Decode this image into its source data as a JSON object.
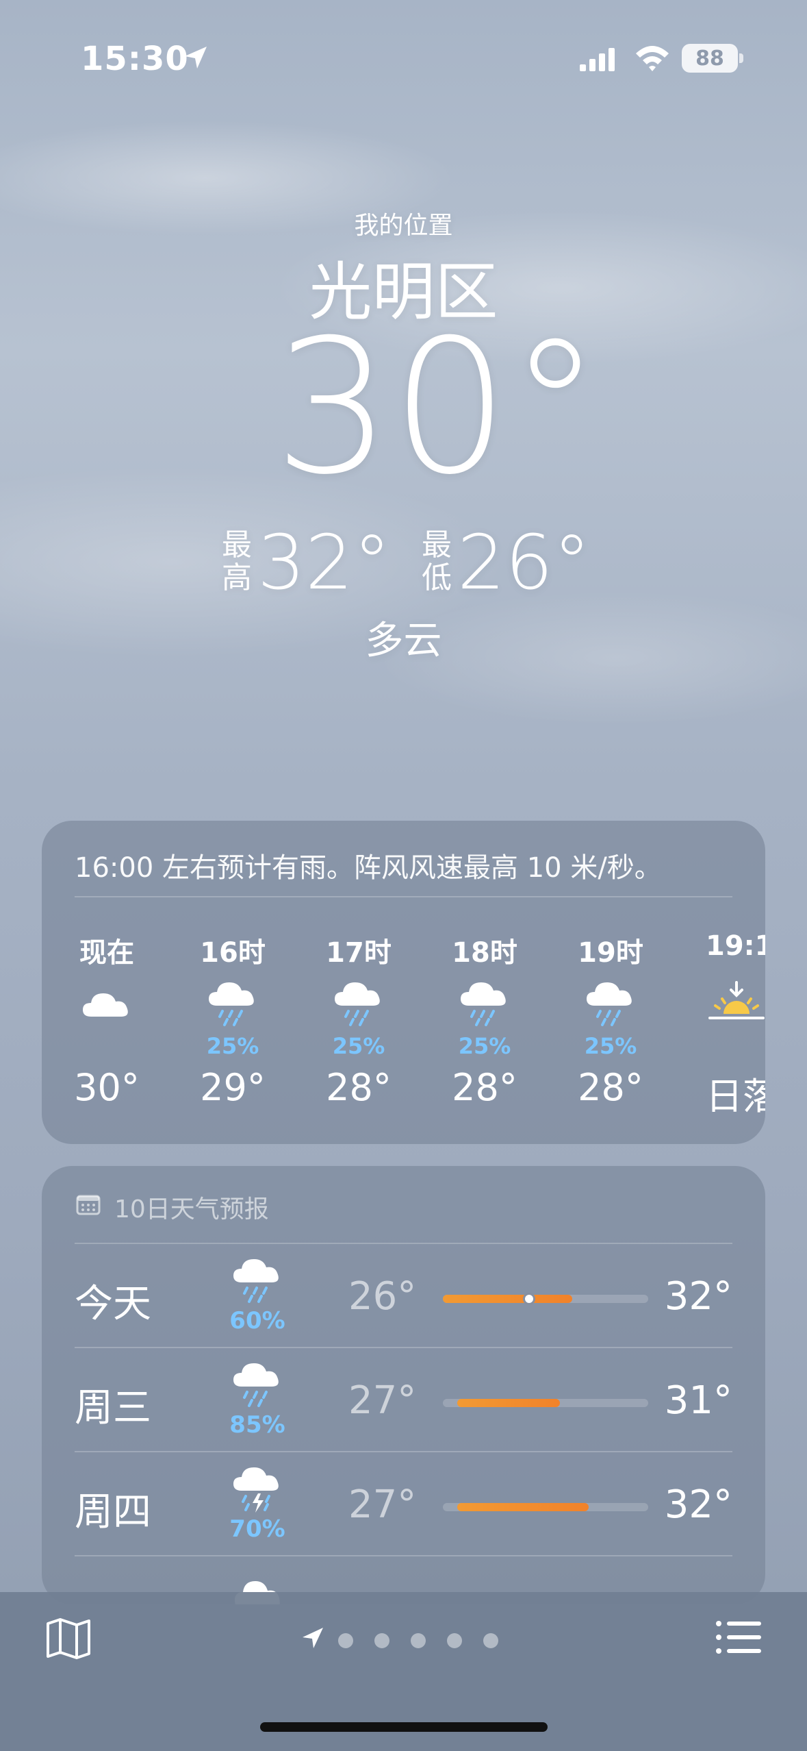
{
  "status_bar": {
    "time": "15:30",
    "battery": "88"
  },
  "header": {
    "my_location": "我的位置",
    "city": "光明区",
    "current_temp": "30°",
    "high_label": "最\n高",
    "high_label_top": "最",
    "high_label_bottom": "高",
    "high": "32°",
    "low_label_top": "最",
    "low_label_bottom": "低",
    "low": "26°",
    "condition": "多云"
  },
  "hourly": {
    "alert": "16:00 左右预计有雨。阵风风速最高 10 米/秒。",
    "hours": [
      {
        "label": "现在",
        "icon": "cloud-icon",
        "prob": "",
        "temp": "30°"
      },
      {
        "label": "16时",
        "icon": "cloud-rain-icon",
        "prob": "25%",
        "temp": "29°"
      },
      {
        "label": "17时",
        "icon": "cloud-rain-icon",
        "prob": "25%",
        "temp": "28°"
      },
      {
        "label": "18时",
        "icon": "cloud-rain-icon",
        "prob": "25%",
        "temp": "28°"
      },
      {
        "label": "19时",
        "icon": "cloud-rain-icon",
        "prob": "25%",
        "temp": "28°"
      },
      {
        "label": "19:1",
        "icon": "sunset-icon",
        "prob": "",
        "temp": "日落"
      }
    ]
  },
  "daily": {
    "title": "10日天气预报",
    "days": [
      {
        "name": "今天",
        "icon": "cloud-rain-icon",
        "prob": "60%",
        "low": "26°",
        "high": "32°",
        "bar_start": 0.0,
        "bar_end": 0.63,
        "current_marker": 0.42
      },
      {
        "name": "周三",
        "icon": "cloud-rain-icon",
        "prob": "85%",
        "low": "27°",
        "high": "31°",
        "bar_start": 0.07,
        "bar_end": 0.57
      },
      {
        "name": "周四",
        "icon": "cloud-thunderstorm-icon",
        "prob": "70%",
        "low": "27°",
        "high": "32°",
        "bar_start": 0.07,
        "bar_end": 0.71
      }
    ]
  },
  "colors": {
    "precip": "#7cc6ff",
    "temp_bar": "#f1822a"
  }
}
